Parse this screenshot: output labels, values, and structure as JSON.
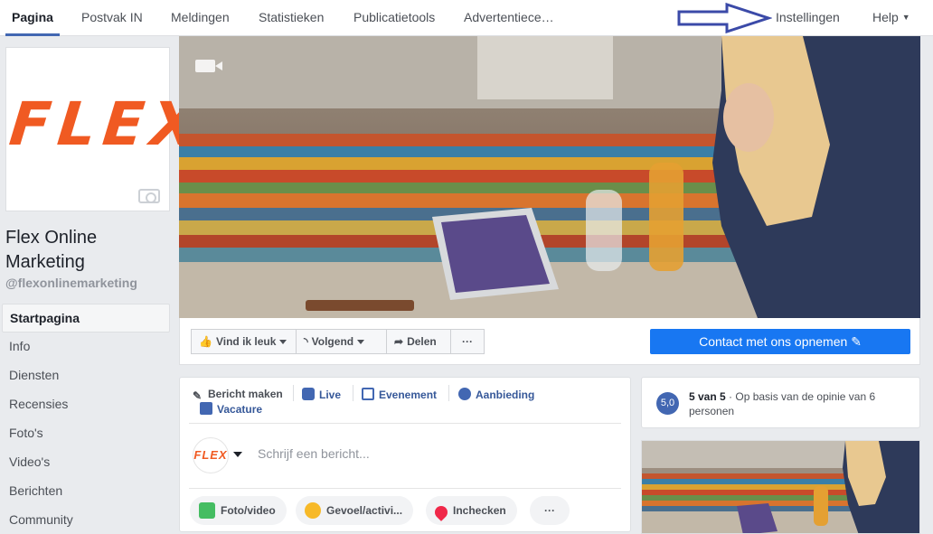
{
  "topnav": {
    "tabs": [
      "Pagina",
      "Postvak IN",
      "Meldingen",
      "Statistieken",
      "Publicatietools",
      "Advertentiece…",
      "Instellingen",
      "Help"
    ]
  },
  "profile": {
    "logo_text": "FLEX",
    "name": "Flex Online Marketing",
    "handle": "@flexonlinemarketing"
  },
  "sidebar": {
    "items": [
      "Startpagina",
      "Info",
      "Diensten",
      "Recensies",
      "Foto's",
      "Video's",
      "Berichten",
      "Community"
    ]
  },
  "actions": {
    "like": "Vind ik leuk",
    "follow": "Volgend",
    "share": "Delen",
    "more": "···",
    "contact": "Contact met ons opnemen"
  },
  "composer": {
    "options": [
      "Bericht maken",
      "Live",
      "Evenement",
      "Aanbieding",
      "Vacature"
    ],
    "avatar_text": "FLEX",
    "placeholder": "Schrijf een bericht...",
    "pills": [
      "Foto/video",
      "Gevoel/activi...",
      "Inchecken",
      "···"
    ]
  },
  "rating": {
    "badge": "5,0",
    "bold": "5 van 5",
    "text": " · Op basis van de opinie van 6 personen"
  },
  "colors": {
    "accent": "#4267b2",
    "primary_button": "#1877f2",
    "brand_orange": "#f05a22",
    "arrow": "#3b4aa8"
  }
}
